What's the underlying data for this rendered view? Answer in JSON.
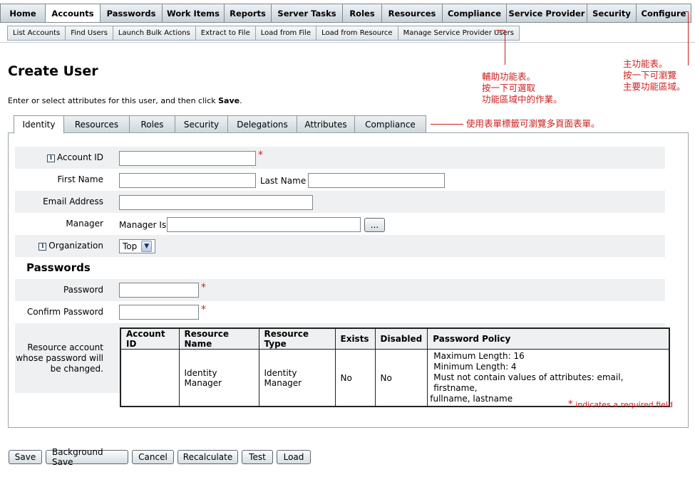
{
  "main_menu": [
    {
      "label": "Home",
      "active": false
    },
    {
      "label": "Accounts",
      "active": true
    },
    {
      "label": "Passwords",
      "active": false
    },
    {
      "label": "Work Items",
      "active": false
    },
    {
      "label": "Reports",
      "active": false
    },
    {
      "label": "Server Tasks",
      "active": false
    },
    {
      "label": "Roles",
      "active": false
    },
    {
      "label": "Resources",
      "active": false
    },
    {
      "label": "Compliance",
      "active": false
    },
    {
      "label": "Service Provider",
      "active": false
    },
    {
      "label": "Security",
      "active": false
    },
    {
      "label": "Configure",
      "active": false
    }
  ],
  "sub_menu": [
    "List Accounts",
    "Find Users",
    "Launch Bulk Actions",
    "Extract to File",
    "Load from File",
    "Load from Resource",
    "Manage Service Provider Users"
  ],
  "page": {
    "title": "Create User",
    "instructions_prefix": "Enter or select attributes for this user, and then click ",
    "instructions_bold": "Save",
    "instructions_suffix": "."
  },
  "callouts": {
    "sub_menu_note": [
      "輔助功能表。",
      "按一下可選取",
      "功能區域中的作業。"
    ],
    "main_menu_note": [
      "主功能表。",
      "按一下可瀏覽",
      "主要功能區域。"
    ],
    "tabs_note": "使用表單標籤可瀏覽多頁面表單。"
  },
  "form_tabs": [
    {
      "label": "Identity",
      "active": true
    },
    {
      "label": "Resources",
      "active": false
    },
    {
      "label": "Roles",
      "active": false
    },
    {
      "label": "Security",
      "active": false
    },
    {
      "label": "Delegations",
      "active": false
    },
    {
      "label": "Attributes",
      "active": false
    },
    {
      "label": "Compliance",
      "active": false
    }
  ],
  "form": {
    "account_id_label": "Account ID",
    "first_name_label": "First Name",
    "last_name_label": "Last Name",
    "email_label": "Email Address",
    "manager_label": "Manager",
    "manager_is_label": "Manager Is:",
    "browse_button": "...",
    "organization_label": "Organization",
    "organization_value": "Top",
    "required_mark": "*",
    "info_glyph": "i",
    "passwords_heading": "Passwords",
    "password_label": "Password",
    "confirm_password_label": "Confirm Password",
    "resource_account_label": "Resource account whose password will be changed."
  },
  "resource_table": {
    "headers": [
      "Account ID",
      "Resource Name",
      "Resource Type",
      "Exists",
      "Disabled",
      "Password Policy"
    ],
    "rows": [
      {
        "account_id": "",
        "resource_name": "Identity Manager",
        "resource_type": "Identity Manager",
        "exists": "No",
        "disabled": "No",
        "policy": [
          "Maximum Length: 16",
          "Minimum Length: 4",
          "Must not contain values of attributes: email, firstname,",
          "fullname, lastname"
        ]
      }
    ]
  },
  "required_note": "indicates a required field",
  "actions": [
    "Save",
    "Background Save",
    "Cancel",
    "Recalculate",
    "Test",
    "Load"
  ],
  "colors": {
    "callout_red": "#cc1f1f",
    "panel_border": "#9aa4ab",
    "row_shade": "#eef0f1"
  }
}
